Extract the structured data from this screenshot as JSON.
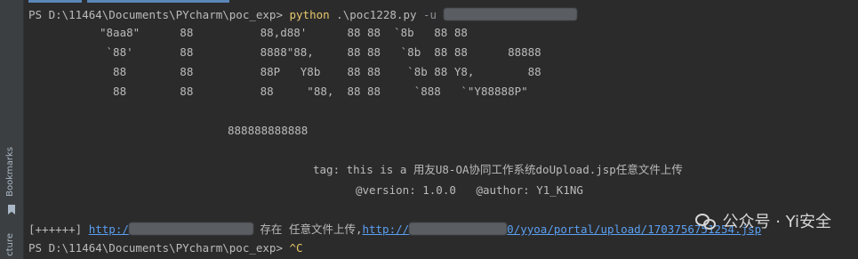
{
  "sidebar": {
    "bookmarks_label": "Bookmarks",
    "structure_label": "cture"
  },
  "terminal": {
    "prompt": "PS D:\\11464\\Documents\\PYcharm\\poc_exp> ",
    "command": "python",
    "script_arg": " .\\poc1228.py ",
    "flag": "-u",
    "banner": [
      "\"8aa8\"      88          88,d88'      88 88  `8b   88 88",
      " `88'       88          8888\"88,     88 88   `8b  88 88      88888",
      "  88        88          88P   Y8b    88 88    `8b 88 Y8,        88",
      "  88        88          88     \"88,  88 88     `888   `\"Y88888P\""
    ],
    "underline": "888888888888",
    "tag_line": "tag: this is a 用友U8-OA协同工作系统doUpload.jsp任意文件上传",
    "version_line": "@version: 1.0.0   @author: Y1_K1NG",
    "result_prefix": "[++++++] ",
    "result_link1": "http:/",
    "result_middle": "存在 任意文件上传,",
    "result_link2_start": "http://",
    "result_link2_end": "0/yyoa/portal/upload/1703756751254.jsp",
    "final_prompt": "PS D:\\11464\\Documents\\PYcharm\\poc_exp> ",
    "interrupt": "^C"
  },
  "watermark": {
    "text": "公众号 · Yi安全"
  }
}
